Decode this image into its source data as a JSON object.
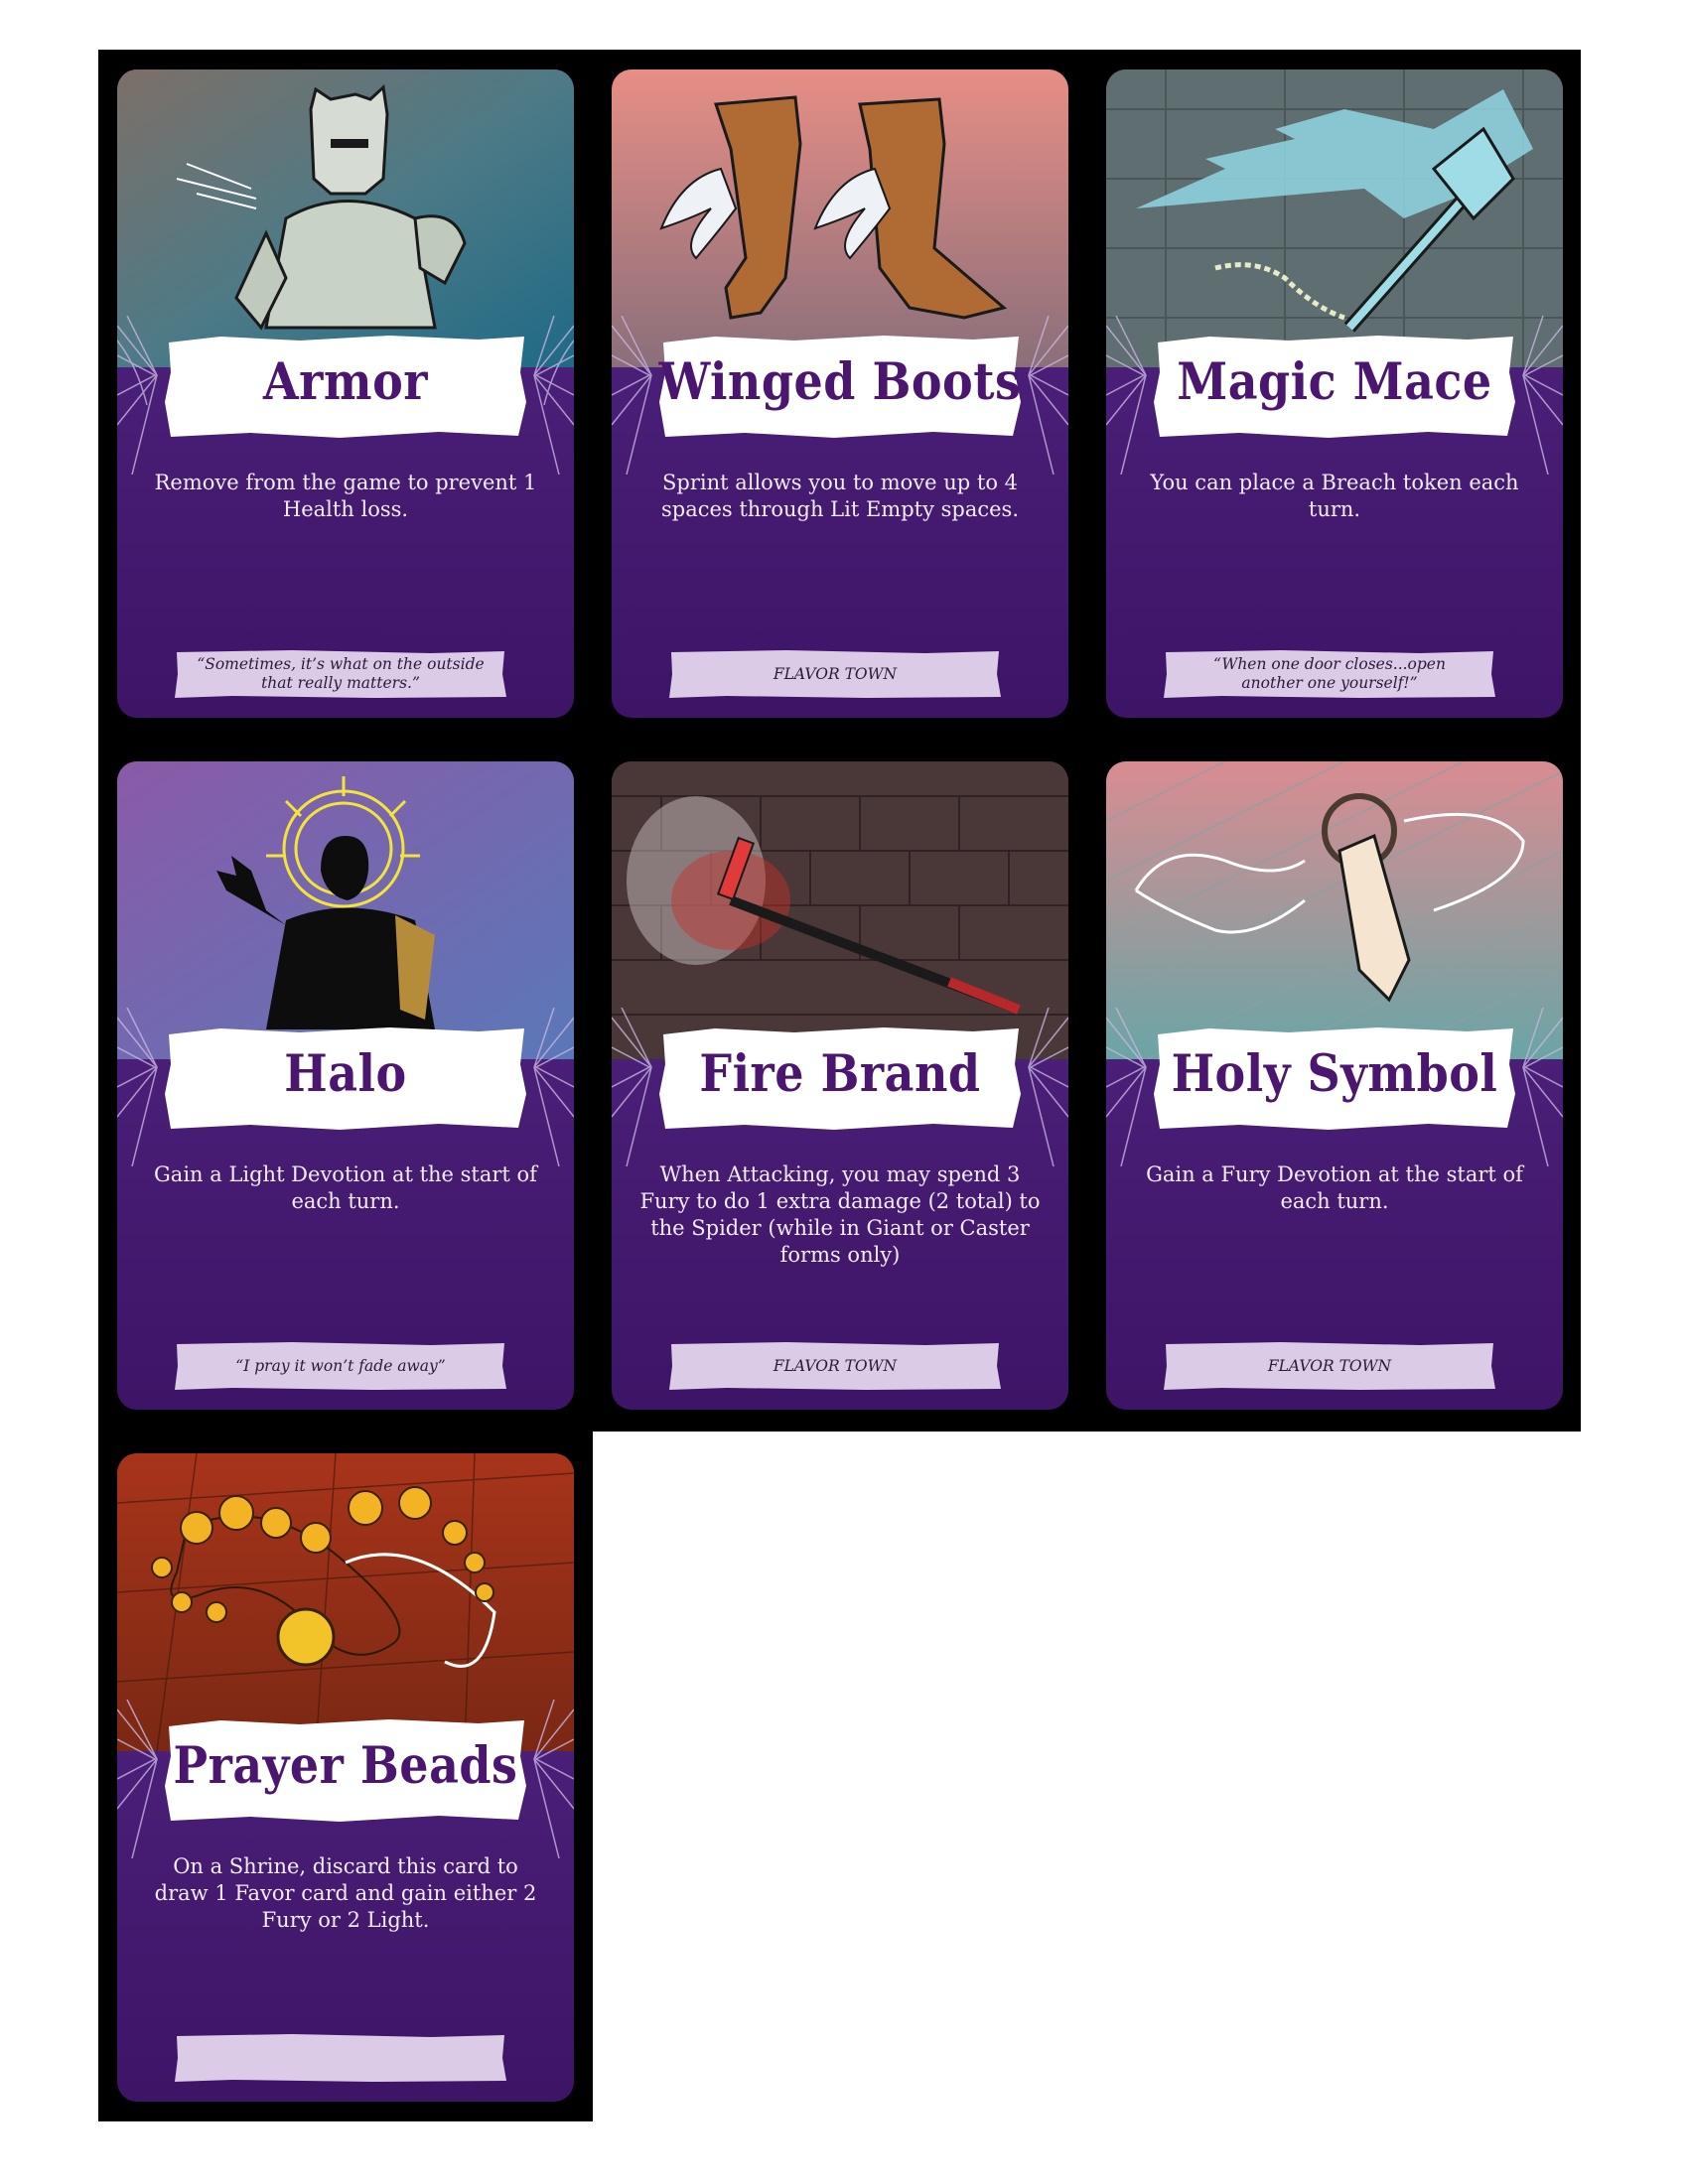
{
  "cards": [
    {
      "title": "Armor",
      "description": "Remove from the game to prevent 1 Health loss.",
      "flavor": "“Sometimes, it’s what on the outside that really matters.”",
      "art": "knight-armor-icon"
    },
    {
      "title": "Winged Boots",
      "description": "Sprint allows you to move up to 4 spaces through Lit Empty spaces.",
      "flavor": "FLAVOR TOWN",
      "art": "winged-boots-icon"
    },
    {
      "title": "Magic Mace",
      "description": "You can place a Breach token each turn.",
      "flavor": "“When one door closes...open another one yourself!”",
      "art": "magic-mace-icon"
    },
    {
      "title": "Halo",
      "description": "Gain a Light Devotion at the start of each turn.",
      "flavor": "“I pray it won’t fade away”",
      "art": "halo-figure-icon"
    },
    {
      "title": "Fire Brand",
      "description": "When Attacking, you may spend 3 Fury to do 1 extra damage (2 total) to the Spider (while in Giant or Caster forms only)",
      "flavor": "FLAVOR TOWN",
      "art": "fire-brand-icon"
    },
    {
      "title": "Holy Symbol",
      "description": "Gain a Fury Devotion at the start of each turn.",
      "flavor": "FLAVOR TOWN",
      "art": "holy-symbol-icon"
    },
    {
      "title": "Prayer Beads",
      "description": "On a Shrine, discard this card to draw 1 Favor card and gain either 2 Fury or 2 Light.",
      "flavor": "",
      "art": "prayer-beads-icon"
    }
  ],
  "colors": {
    "card_purple": "#4a1f78",
    "title_purple": "#4a1670",
    "flavor_lavender": "#dccbe6",
    "sheet_black": "#000000"
  }
}
